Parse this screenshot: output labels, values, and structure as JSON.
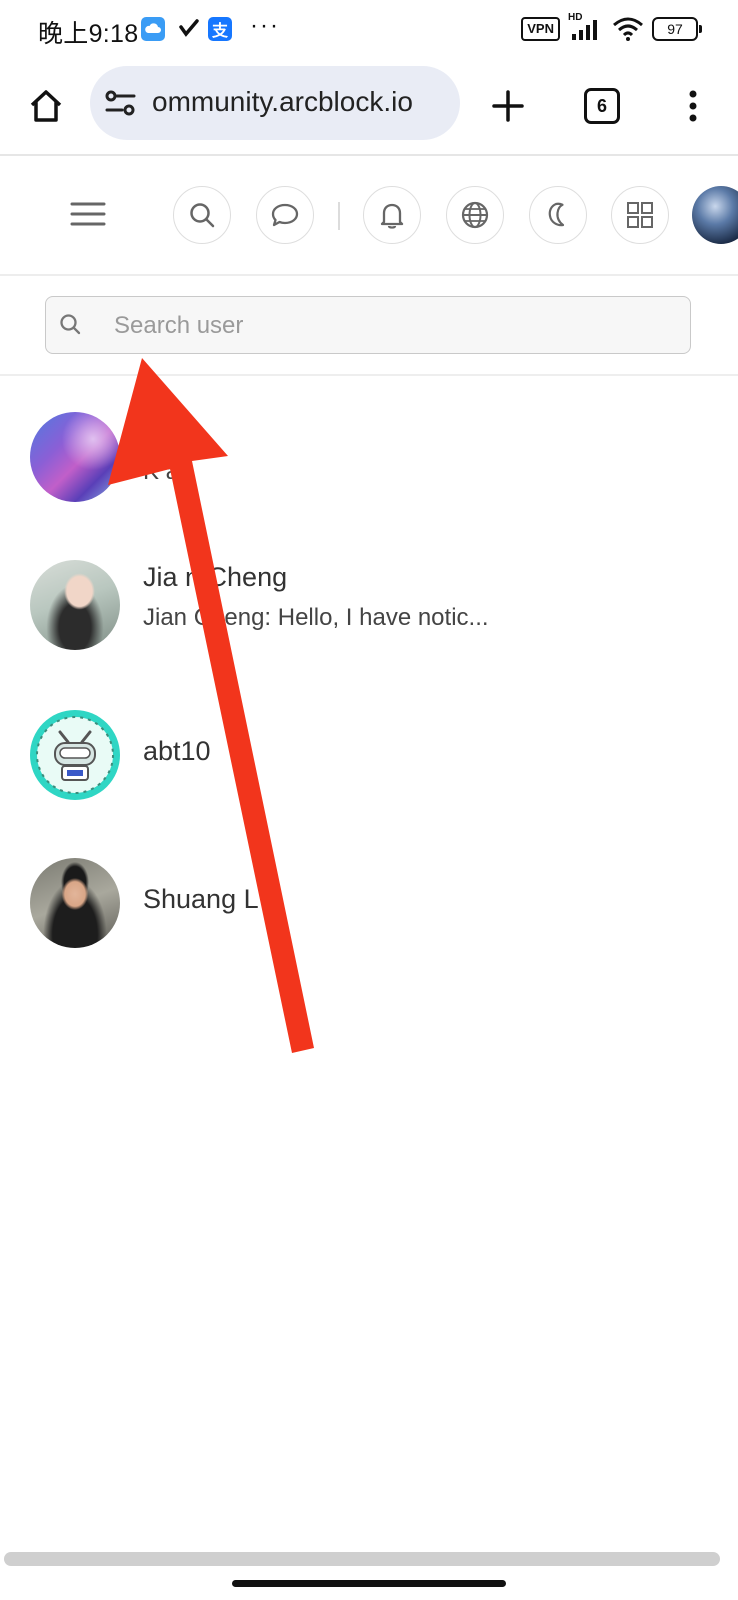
{
  "status_bar": {
    "time": "晚上9:18",
    "app_icons": [
      "cloud-app-icon",
      "check-app-icon",
      "alipay-app-icon"
    ],
    "alipay_glyph": "支",
    "more": "···",
    "vpn": "VPN",
    "network": "HD",
    "battery": "97"
  },
  "browser": {
    "url": "ommunity.arcblock.io",
    "tab_count": "6"
  },
  "search": {
    "placeholder": "Search user"
  },
  "conversations": [
    {
      "name": "",
      "preview": "K a:",
      "avatar": "purple-abstract"
    },
    {
      "name": "Jia n Cheng",
      "preview": "Jian Cheng: Hello, I have notic...",
      "avatar": "photo-girl"
    },
    {
      "name": "abt10",
      "preview": "",
      "avatar": "robot-teal"
    },
    {
      "name": "Shuang L",
      "preview": "",
      "avatar": "photo-man"
    }
  ],
  "colors": {
    "arrow": "#f2351c",
    "url_pill": "#e9ecf5"
  }
}
